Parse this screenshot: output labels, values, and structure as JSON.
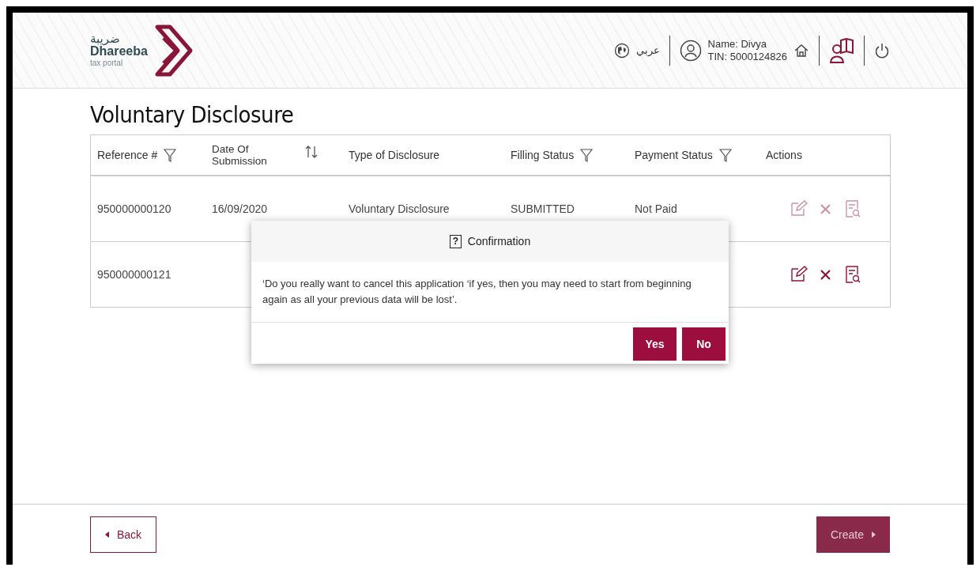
{
  "header": {
    "logo": {
      "arabic": "ضريبة",
      "name": "Dhareeba",
      "tagline": "tax portal"
    },
    "language": "عربي",
    "user": {
      "name": "Name: Divya",
      "tin": "TIN: 5000124826"
    }
  },
  "page_title": "Voluntary Disclosure",
  "table": {
    "columns": [
      {
        "label": "Reference #",
        "kind": "filter"
      },
      {
        "label": "Date Of Submission",
        "kind": "sort"
      },
      {
        "label": "Type of Disclosure",
        "kind": "plain"
      },
      {
        "label": "Filling Status",
        "kind": "filter"
      },
      {
        "label": "Payment Status",
        "kind": "filter"
      },
      {
        "label": "Actions",
        "kind": "plain"
      }
    ],
    "rows": [
      {
        "cells": [
          "950000000120",
          "16/09/2020",
          "Voluntary Disclosure",
          "SUBMITTED",
          "Not Paid"
        ],
        "actions_disabled": true
      },
      {
        "cells": [
          "950000000121"
        ],
        "actions_disabled": false
      }
    ]
  },
  "dialog": {
    "icon": "?",
    "title": "Confirmation",
    "message": "‘Do you really want to cancel this application ‘if yes, then you may need to start from beginning again as all your previous data will be lost’.",
    "buttons": [
      "Yes",
      "No"
    ]
  },
  "footer": {
    "back": "Back",
    "create": "Create",
    "create_disabled": true
  }
}
